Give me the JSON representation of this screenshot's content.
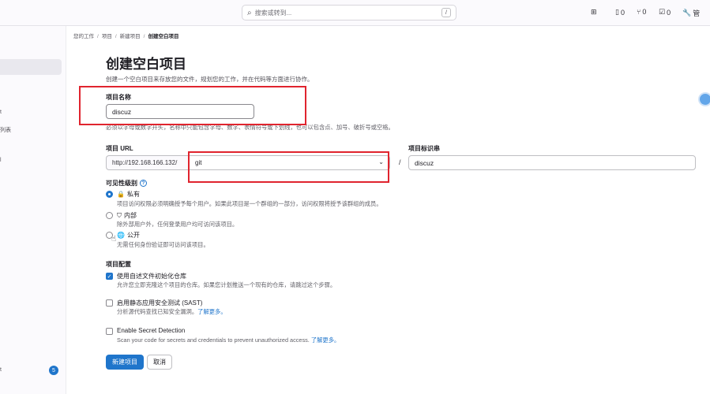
{
  "topbar": {
    "search_placeholder": "搜索或转到...",
    "search_shortcut": "/",
    "issues_count": "0",
    "mr_count": "0",
    "todo_count": "0",
    "admin_label": "管"
  },
  "sidebar": {
    "text_a": "t",
    "text_b": "列表",
    "text_c": "l",
    "text_d": "t",
    "badge": "5"
  },
  "breadcrumb": [
    "您的工作",
    "项目",
    "新建项目",
    "创建空白项目"
  ],
  "page": {
    "title": "创建空白项目",
    "subtitle": "创建一个空白项目来存放您的文件，规划您的工作，并在代码等方面进行协作。"
  },
  "project_name": {
    "label": "项目名称",
    "value": "discuz",
    "help": "必须以字母或数字开头，名称中只能包含字母、数字、表情符号或下划线，也可以包含点、加号、破折号或空格。"
  },
  "project_url": {
    "label": "项目 URL",
    "prefix": "http://192.168.166.132/",
    "namespace": "git",
    "separator": "/"
  },
  "project_slug": {
    "label": "项目标识串",
    "value": "discuz"
  },
  "visibility": {
    "label": "可见性级别",
    "help_icon": "?",
    "options": [
      {
        "icon": "lock-icon",
        "name": "私有",
        "desc": "项目访问权限必须明确授予每个用户。如果此项目是一个群组的一部分，访问权限将授予该群组的成员。",
        "selected": true
      },
      {
        "icon": "shield-icon",
        "name": "内部",
        "desc": "除外部用户外，任何登录用户均可访问该项目。",
        "selected": false
      },
      {
        "icon": "globe-icon",
        "name": "公开",
        "desc": "无需任何身份验证即可访问该项目。",
        "selected": false
      }
    ]
  },
  "config": {
    "label": "项目配置",
    "options": [
      {
        "name": "使用自述文件初始化仓库",
        "desc": "允许您立即克隆这个项目的仓库。如果您计划推送一个现有的仓库，请跳过这个步骤。",
        "link": "",
        "checked": true
      },
      {
        "name": "启用静态应用安全测试 (SAST)",
        "desc": "分析源代码查找已知安全漏洞。",
        "link": "了解更多。",
        "checked": false
      },
      {
        "name": "Enable Secret Detection",
        "desc": "Scan your code for secrets and credentials to prevent unauthorized access.",
        "link": "了解更多。",
        "checked": false
      }
    ]
  },
  "actions": {
    "create": "新建项目",
    "cancel": "取消"
  },
  "colors": {
    "accent": "#1f75cb",
    "annotation": "#e0242e"
  }
}
